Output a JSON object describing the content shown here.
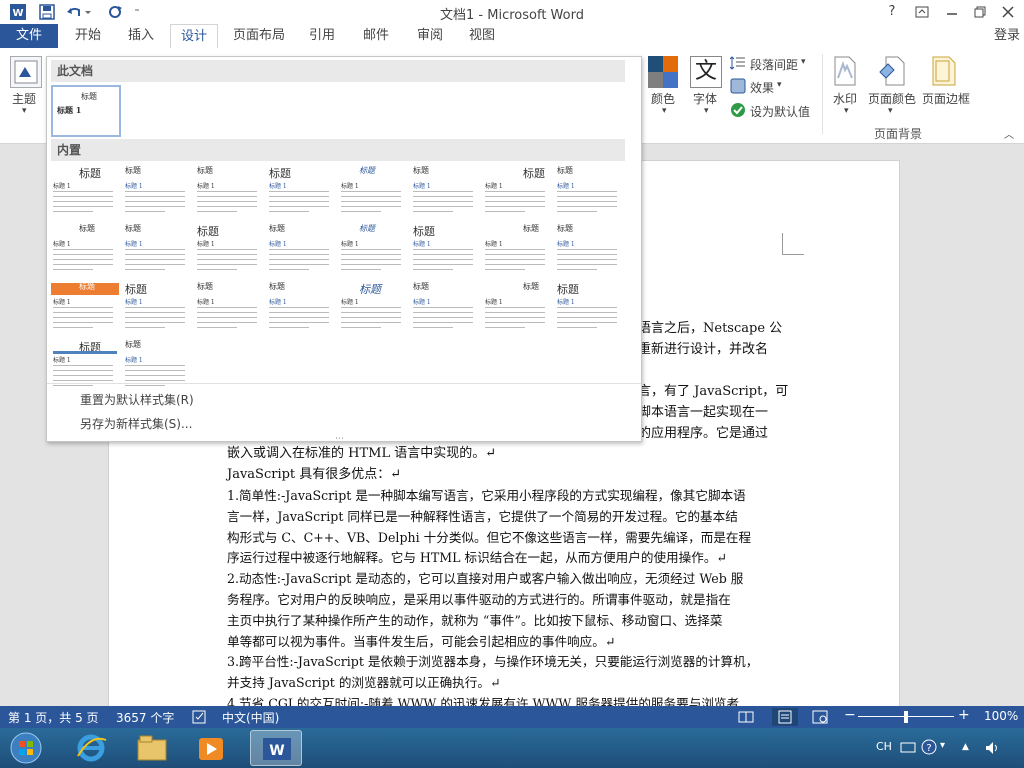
{
  "titlebar": {
    "title": "文档1 - Microsoft Word",
    "help": "?",
    "qat_customize": "⁼"
  },
  "tabs": [
    "文件",
    "开始",
    "插入",
    "设计",
    "页面布局",
    "引用",
    "邮件",
    "审阅",
    "视图"
  ],
  "signin": "登录",
  "ribbon": {
    "theme_label": "主题",
    "colors_label": "颜色",
    "fonts_label": "字体",
    "font_icon_glyph": "文",
    "para_spacing": "段落间距",
    "effects": "效果",
    "set_default": "设为默认值",
    "watermark": "水印",
    "page_color": "页面颜色",
    "page_border": "页面边框",
    "group_page_background": "页面背景"
  },
  "gallery": {
    "section_this_doc": "此文档",
    "section_builtin": "内置",
    "thumb_title": "标题",
    "thumb_heading1": "标题 1",
    "reset": "重置为默认样式集(R)",
    "save_as": "另存为新样式集(S)..."
  },
  "document": {
    "lines": [
      "语言之后，Netscape 公",
      "重新进行设计，并改名",
      "言，有了 JavaScript，可",
      "脚本语言一起实现在一",
      "的应用程序。它是通过",
      "嵌入或调入在标准的 HTML 语言中实现的。↵",
      "JavaScript 具有很多优点：↵",
      "1.简单性:-JavaScript 是一种脚本编写语言，它采用小程序段的方式实现编程，像其它脚本语",
      "言一样，JavaScript 同样已是一种解释性语言，它提供了一个简易的开发过程。它的基本结",
      "构形式与 C、C++、VB、Delphi 十分类似。但它不像这些语言一样，需要先编译，而是在程",
      "序运行过程中被逐行地解释。它与 HTML 标识结合在一起，从而方便用户的使用操作。↵",
      "2.动态性:-JavaScript 是动态的，它可以直接对用户或客户输入做出响应，无须经过 Web 服",
      "务程序。它对用户的反映响应，是采用以事件驱动的方式进行的。所谓事件驱动，就是指在",
      "主页中执行了某种操作所产生的动作，就称为 “事件”。比如按下鼠标、移动窗口、选择菜",
      "单等都可以视为事件。当事件发生后，可能会引起相应的事件响应。↵",
      "3.跨平台性:-JavaScript 是依赖于浏览器本身，与操作环境无关，只要能运行浏览器的计算机，",
      "并支持 JavaScript 的浏览器就可以正确执行。↵",
      "4.节省 CGI 的交互时间:-随着 WWW 的迅速发展有许 WWW 服务器提供的服务要与浏览者"
    ]
  },
  "statusbar": {
    "page": "第 1 页，共 5 页",
    "words": "3657 个字",
    "language": "中文(中国)",
    "zoom": "100%",
    "zoom_minus": "−",
    "zoom_plus": "+"
  },
  "taskbar": {
    "ime": "CH"
  },
  "colors": {
    "word_blue": "#2b579a",
    "taskbar": "#245a86"
  }
}
